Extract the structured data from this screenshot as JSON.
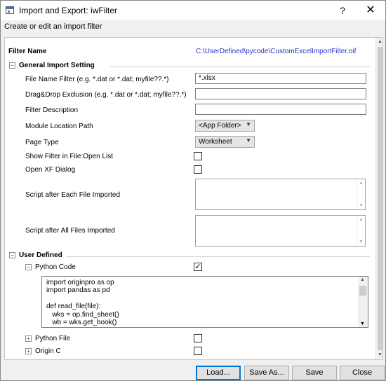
{
  "window": {
    "title": "Import and Export: iwFilter",
    "help_glyph": "?",
    "close_glyph": "✕",
    "subtitle": "Create or edit an import filter"
  },
  "filter_name": {
    "label": "Filter Name",
    "value": "C:\\UserDefined\\pycode\\CustomExcelImportFilter.oif"
  },
  "general": {
    "header": "General Import Setting",
    "expander": "−",
    "file_name_filter": {
      "label": "File Name Filter (e.g. *.dat or *.dat; myfile??.*)",
      "value": "*.xlsx"
    },
    "drag_drop_exclusion": {
      "label": "Drag&Drop Exclusion (e.g. *.dat or *.dat; myfile??.*)",
      "value": ""
    },
    "filter_description": {
      "label": "Filter Description",
      "value": ""
    },
    "module_location": {
      "label": "Module Location Path",
      "value": "<App Folder>"
    },
    "page_type": {
      "label": "Page Type",
      "value": "Worksheet"
    },
    "show_filter": {
      "label": "Show Filter in File:Open List",
      "checked": false
    },
    "open_xf": {
      "label": "Open XF Dialog",
      "checked": false
    },
    "script_each": {
      "label": "Script after Each File Imported",
      "value": ""
    },
    "script_all": {
      "label": "Script after All Files Imported",
      "value": ""
    }
  },
  "user_defined": {
    "header": "User Defined",
    "expander": "−",
    "python_code": {
      "label": "Python Code",
      "expander": "−",
      "checked": true,
      "check_glyph": "✓",
      "lines": [
        "import originpro as op",
        "import pandas as pd",
        "",
        "def read_file(file):",
        "   wks = op.find_sheet()",
        "   wb = wks.get_book()"
      ]
    },
    "python_file": {
      "label": "Python File",
      "expander": "+",
      "checked": false
    },
    "origin_c": {
      "label": "Origin C",
      "expander": "+",
      "checked": false
    }
  },
  "buttons": {
    "load": "Load...",
    "save_as": "Save As...",
    "save": "Save",
    "close": "Close"
  },
  "glyphs": {
    "dropdown": "▼",
    "up": "▲",
    "down": "▼"
  }
}
